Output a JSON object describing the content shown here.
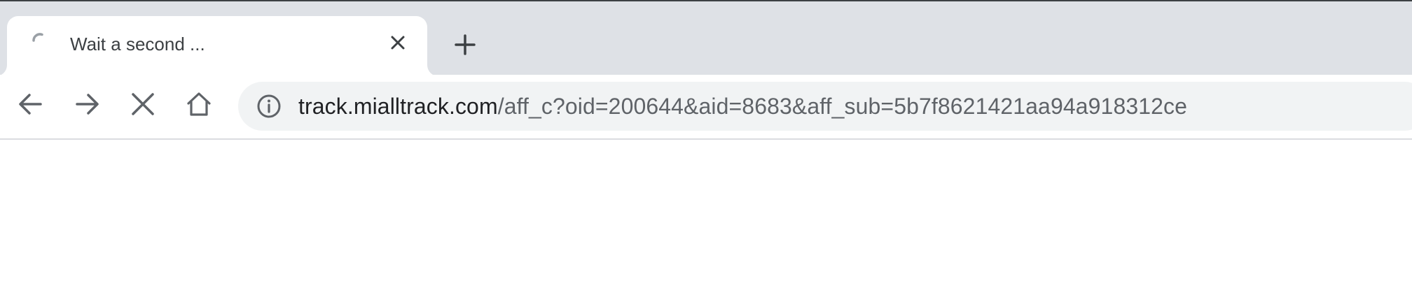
{
  "tab": {
    "title": "Wait a second ...",
    "loading_icon": "spinner-icon",
    "close_icon": "close-icon"
  },
  "tabstrip": {
    "new_tab_icon": "plus-icon"
  },
  "toolbar": {
    "back_icon": "arrow-left-icon",
    "forward_icon": "arrow-right-icon",
    "stop_icon": "stop-x-icon",
    "home_icon": "home-icon"
  },
  "omnibox": {
    "security_icon": "info-circle-icon",
    "url_host": "track.mialltrack.com",
    "url_path": "/aff_c?oid=200644&aid=8683&aff_sub=5b7f8621421aa94a918312ce"
  },
  "colors": {
    "tabstrip_bg": "#dee1e6",
    "omnibox_bg": "#f1f3f4",
    "icon": "#5f6368",
    "text": "#3c4043"
  }
}
